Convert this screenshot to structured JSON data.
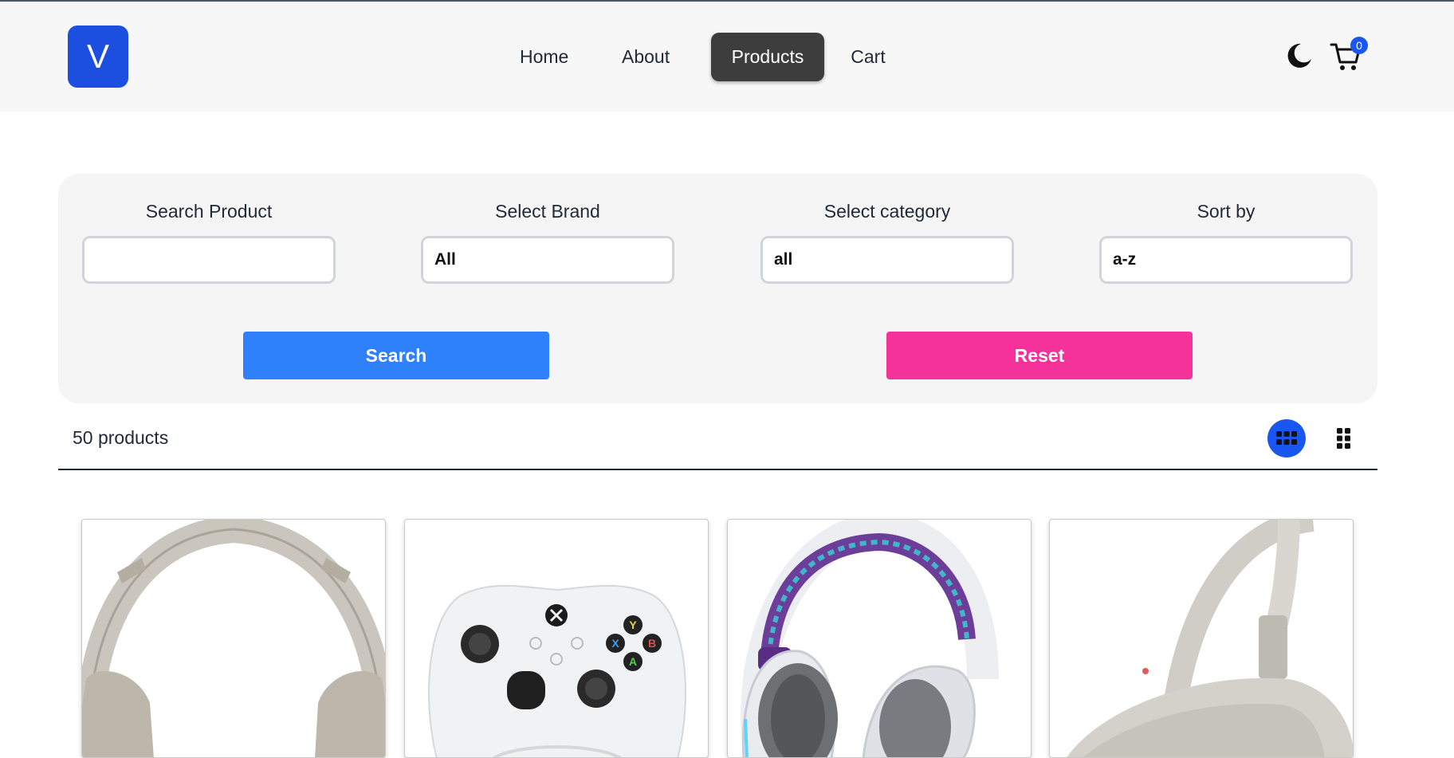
{
  "header": {
    "logo_letter": "V",
    "nav": {
      "home": "Home",
      "about": "About",
      "products": "Products",
      "cart": "Cart"
    },
    "cart_count": "0",
    "icons": [
      "moon-icon",
      "cart-icon"
    ]
  },
  "filters": {
    "search": {
      "label": "Search Product",
      "value": ""
    },
    "brand": {
      "label": "Select Brand",
      "value": "All"
    },
    "category": {
      "label": "Select category",
      "value": "all"
    },
    "sort": {
      "label": "Sort by",
      "value": "a-z"
    },
    "search_button": "Search",
    "reset_button": "Reset",
    "colors": {
      "search": "#2f80fb",
      "reset": "#f5329a"
    }
  },
  "results": {
    "count_text": "50 products",
    "icons": [
      "grid-view-icon",
      "compact-grid-view-icon"
    ],
    "active_view": "grid"
  },
  "products": [
    {
      "image": "over-ear-headphones-beige"
    },
    {
      "image": "white-game-controller"
    },
    {
      "image": "white-gaming-headset-rgb"
    },
    {
      "image": "over-ear-headphones-silver"
    }
  ],
  "colors": {
    "accent": "#1a56f2",
    "active_nav": "#3d3d3d"
  }
}
